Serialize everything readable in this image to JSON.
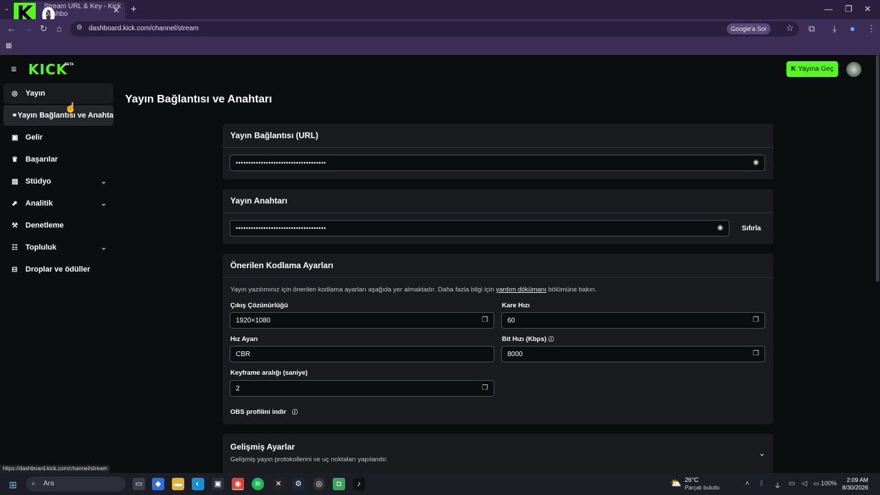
{
  "browser": {
    "tab_title": "Stream URL & Key - Kick Dashbo",
    "url": "dashboard.kick.com/channel/stream",
    "google_button": "Google'a Sor",
    "status_url": "https://dashboard.kick.com/channel/stream",
    "overlay_logo": "K",
    "overlay_number": "0"
  },
  "header": {
    "logo": "KICK",
    "logo_badge": "BETA",
    "go_live": "Yayına Geç"
  },
  "sidebar": {
    "items": [
      {
        "label": "Yayın",
        "icon": "broadcast-icon"
      },
      {
        "label": "Yayın Bağlantısı ve Anahtarı",
        "icon": "link-icon"
      },
      {
        "label": "Gelir",
        "icon": "revenue-icon"
      },
      {
        "label": "Başarılar",
        "icon": "trophy-icon"
      },
      {
        "label": "Stüdyo",
        "icon": "studio-icon"
      },
      {
        "label": "Analitik",
        "icon": "analytics-icon"
      },
      {
        "label": "Denetleme",
        "icon": "wrench-icon"
      },
      {
        "label": "Topluluk",
        "icon": "community-icon"
      },
      {
        "label": "Droplar ve ödüller",
        "icon": "gift-icon"
      }
    ]
  },
  "main": {
    "title": "Yayın Bağlantısı ve Anahtarı",
    "url_card": {
      "heading": "Yayın Bağlantısı (URL)",
      "masked_value": "••••••••••••••••••••••••••••••••••••"
    },
    "key_card": {
      "heading": "Yayın Anahtarı",
      "masked_value": "••••••••••••••••••••••••••••••••••••",
      "reset_label": "Sıfırla"
    },
    "encoding": {
      "heading": "Önerilen Kodlama Ayarları",
      "hint_before": "Yayın yazılımınız için önerilen kodlama ayarları aşağıda yer almaktadır. Daha fazla bilgi için ",
      "hint_link": "yardım dökümanı",
      "hint_after": " bölümüne bakın.",
      "resolution_label": "Çıkış Çözünürlüğü",
      "resolution_value": "1920×1080",
      "framerate_label": "Kare Hızı",
      "framerate_value": "60",
      "rate_control_label": "Hız Ayarı",
      "rate_control_value": "CBR",
      "bitrate_label": "Bit Hızı (Kbps)",
      "bitrate_value": "8000",
      "keyframe_label": "Keyframe aralığı (saniye)",
      "keyframe_value": "2",
      "obs_label": "OBS profilini indir"
    },
    "advanced": {
      "heading": "Gelişmiş Ayarlar",
      "subtitle": "Gelişmiş yayın protokollerini ve uç noktaları yapılandır."
    }
  },
  "taskbar": {
    "search_placeholder": "Ara",
    "weather_temp": "26°C",
    "weather_desc": "Parçalı bulutlu",
    "battery": "100%",
    "time": "2:09 AM",
    "date": "8/30/2026"
  },
  "colors": {
    "accent": "#53fc18",
    "background": "#0b0e0f",
    "card": "#191b1f",
    "browser": "#3d2e57"
  }
}
